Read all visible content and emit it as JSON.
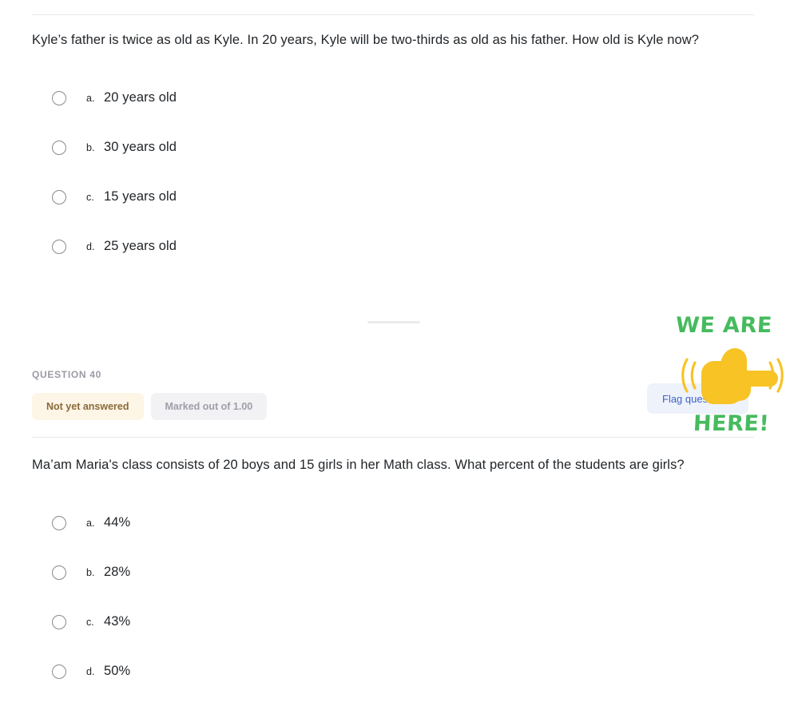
{
  "questions": [
    {
      "text": "Kyle’s father is twice as old as Kyle. In 20 years, Kyle will be two-thirds as old as his father. How old is Kyle now?",
      "options": [
        {
          "letter": "a.",
          "text": "20 years old"
        },
        {
          "letter": "b.",
          "text": "30 years old"
        },
        {
          "letter": "c.",
          "text": "15 years old"
        },
        {
          "letter": "d.",
          "text": "25 years old"
        }
      ]
    },
    {
      "number_label": "QUESTION 40",
      "status_badge": "Not yet answered",
      "mark_badge": "Marked out of 1.00",
      "flag_label": "Flag question",
      "text": "Ma’am Maria's class consists of 20 boys and 15 girls in her Math class. What percent of the students are girls?",
      "options": [
        {
          "letter": "a.",
          "text": "44%"
        },
        {
          "letter": "b.",
          "text": "28%"
        },
        {
          "letter": "c.",
          "text": "43%"
        },
        {
          "letter": "d.",
          "text": "50%"
        }
      ]
    }
  ],
  "annotation": {
    "line1": "WE ARE",
    "line2": "HERE!",
    "icon": "pointing-hand-right-icon",
    "text_color": "#46bb5e",
    "hand_color": "#f7c325"
  },
  "colors": {
    "status_badge_bg": "#fdf5e6",
    "status_badge_text": "#8a6a3a",
    "mark_badge_bg": "#f2f2f4",
    "mark_badge_text": "#9e9eaa",
    "flag_button_bg": "#eef2fa",
    "flag_button_text": "#3b63c7",
    "rule": "#e8e8ea"
  }
}
